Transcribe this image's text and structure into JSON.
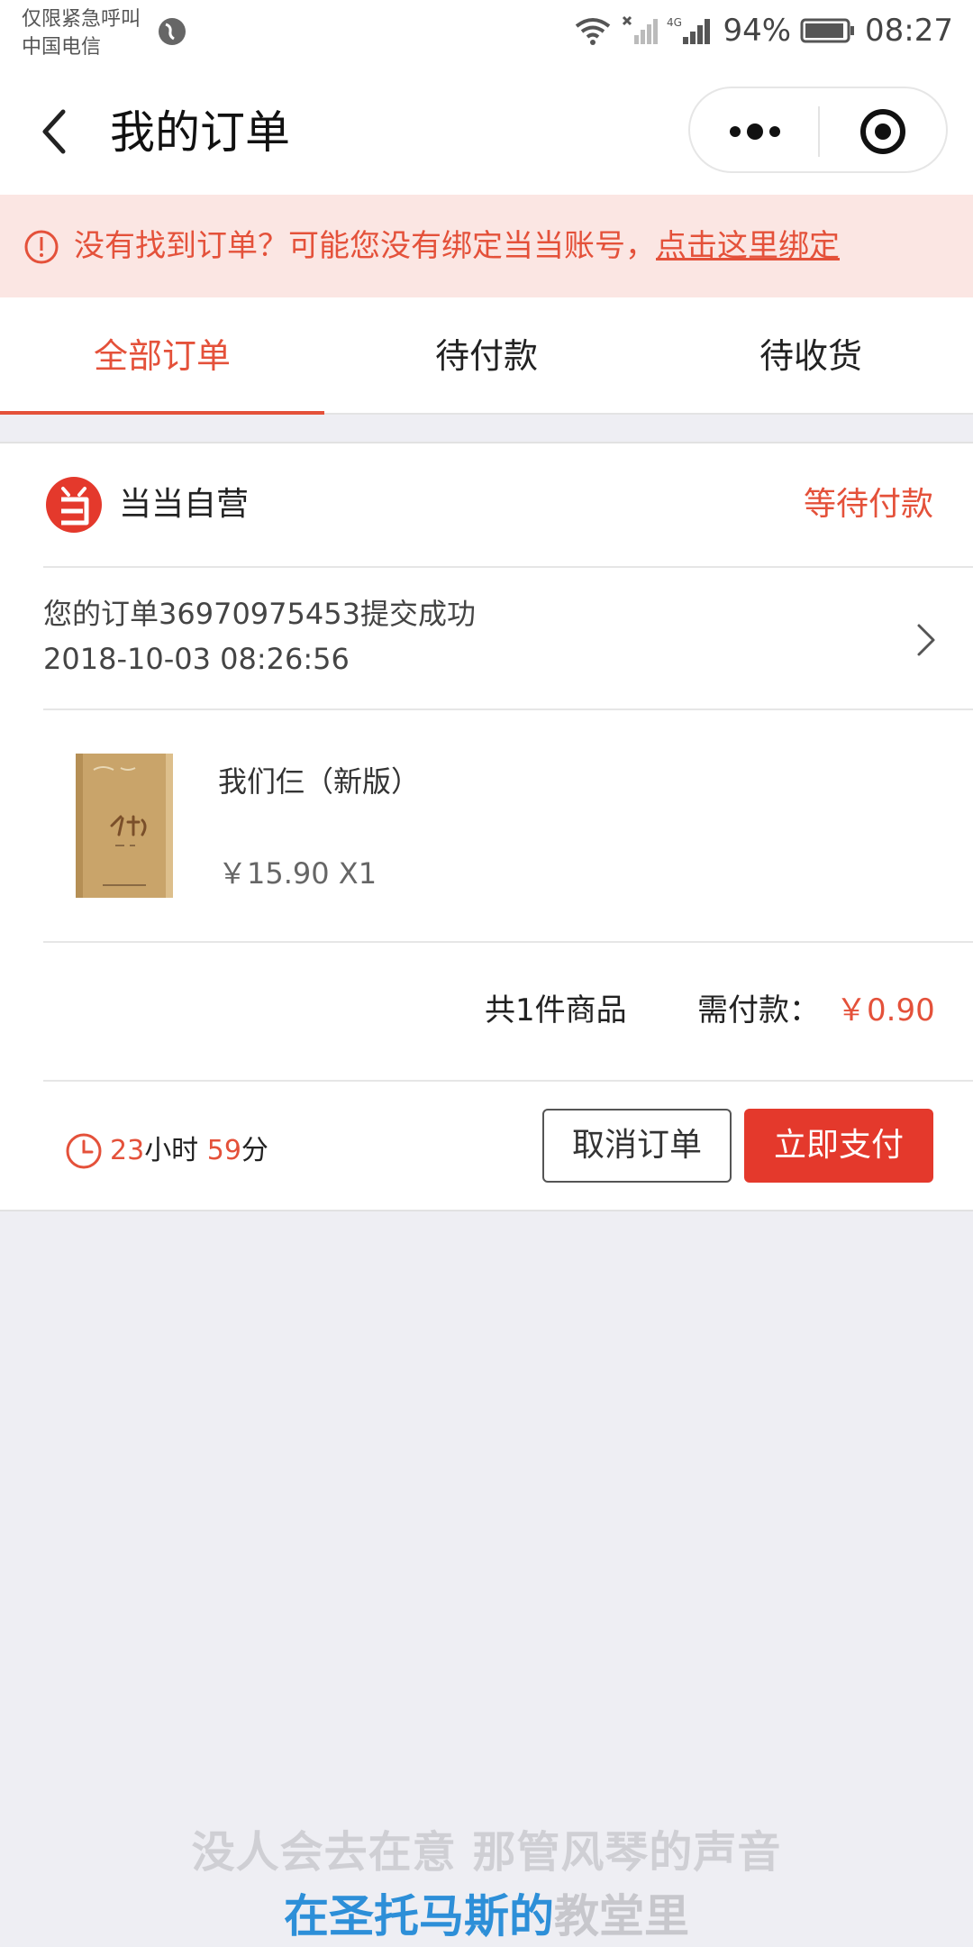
{
  "status_bar": {
    "carrier_line1": "仅限紧急呼叫",
    "carrier_line2": "中国电信",
    "network": "4G",
    "battery": "94%",
    "time": "08:27"
  },
  "header": {
    "title": "我的订单"
  },
  "notice": {
    "text": "没有找到订单？可能您没有绑定当当账号，",
    "link": "点击这里绑定"
  },
  "tabs": [
    {
      "label": "全部订单",
      "active": true
    },
    {
      "label": "待付款",
      "active": false
    },
    {
      "label": "待收货",
      "active": false
    }
  ],
  "order": {
    "shop_name": "当当自营",
    "status": "等待付款",
    "message": "您的订单36970975453提交成功",
    "datetime": "2018-10-03 08:26:56",
    "product": {
      "title": "我们仨（新版）",
      "price_qty": "￥15.90 X1"
    },
    "summary": {
      "count": "共1件商品",
      "due_label": "需付款：",
      "due_amount": "￥0.90"
    },
    "countdown": {
      "hours": "23",
      "hours_unit": "小时",
      "minutes": "59",
      "minutes_unit": "分"
    },
    "buttons": {
      "cancel": "取消订单",
      "pay": "立即支付"
    }
  },
  "video_subtitles": {
    "line1": "没人会去在意 那管风琴的声音",
    "line2_highlight": "在圣托马斯的",
    "line2_rest": "教堂里"
  },
  "colors": {
    "accent": "#e4513a",
    "pay_button": "#e4392c",
    "notice_bg": "#fbe6e3",
    "page_bg": "#eeeef3"
  }
}
